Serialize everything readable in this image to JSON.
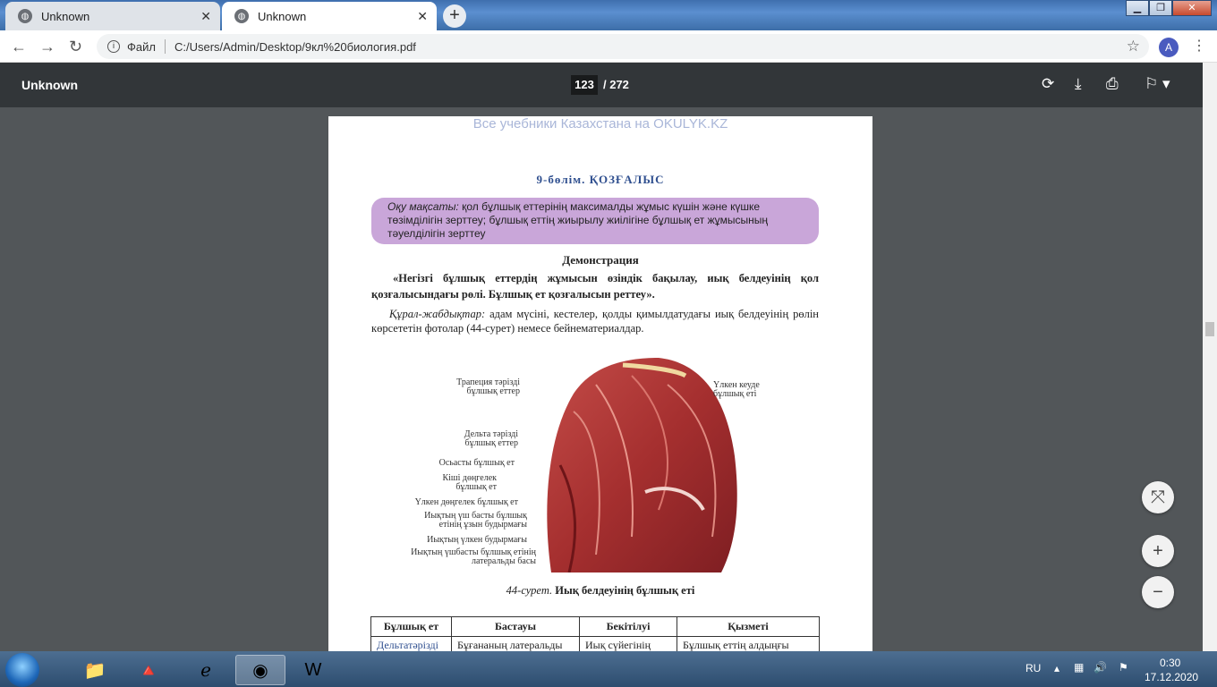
{
  "browser": {
    "tabs": [
      {
        "label": "Unknown",
        "active": false
      },
      {
        "label": "Unknown",
        "active": true
      }
    ],
    "address": {
      "scheme_label": "Файл",
      "url": "C:/Users/Admin/Desktop/9кл%20биология.pdf"
    },
    "profile_initial": "A"
  },
  "pdf_toolbar": {
    "title": "Unknown",
    "current_page": "123",
    "total_pages": "/ 272"
  },
  "page": {
    "watermark": "Все учебники Казахстана на OKULYK.KZ",
    "section": "9-бөлім. ҚОЗҒАЛЫС",
    "goal_label": "Оқу мақсаты:",
    "goal_text": "қол бұлшық еттерінің максималды жұмыс күшін және күшке төзімділігін зерттеу; бұлшық еттің жиырылу жиілігіне бұлшық ет жұмысының тәуелділігін зерттеу",
    "demo_heading": "Демонстрация",
    "demo_title": "«Негізгі бұлшық еттердің жұмысын өзіндік бақылау, иық белдеуінің қол қозғалысындағы рөлі. Бұлшық ет қозғалысын реттеу».",
    "equipment_label": "Құрал-жабдықтар:",
    "equipment_text": "адам мүсіні, кестелер, қолды қимылдатудағы иық белдеуінің рөлін көрсететін фотолар (44-сурет) немесе бейнематериалдар.",
    "figure_labels": [
      "Трапеция тәрізді бұлшық еттер",
      "Дельта тәрізді бұлшық еттер",
      "Осьасты бұлшық ет",
      "Кіші дөңгелек бұлшық ет",
      "Үлкен дөңгелек бұлшық ет",
      "Иықтың үш басты бұлшық етінің ұзын будырмағы",
      "Иықтың үлкен будырмағы",
      "Иықтың үшбасты бұлшық етінің латеральды басы",
      "Үлкен кеуде бұлшық еті"
    ],
    "caption_num": "44-сурет.",
    "caption_text": "Иық белдеуінің бұлшық еті",
    "table": {
      "headers": [
        "Бұлшық ет",
        "Бастауы",
        "Бекітілуі",
        "Қызметі"
      ],
      "rows": [
        [
          "Дельтатәрізді",
          "Бұғананың латеральды",
          "Иық сүйегінің",
          "Бұлшық еттің алдыңғы"
        ]
      ]
    }
  },
  "taskbar": {
    "lang": "RU",
    "time": "0:30",
    "date": "17.12.2020"
  },
  "colors": {
    "goal_box": "#c9a6d9",
    "section_title": "#2f4f8f",
    "pdf_toolbar": "#323639",
    "viewer_bg": "#525659"
  }
}
